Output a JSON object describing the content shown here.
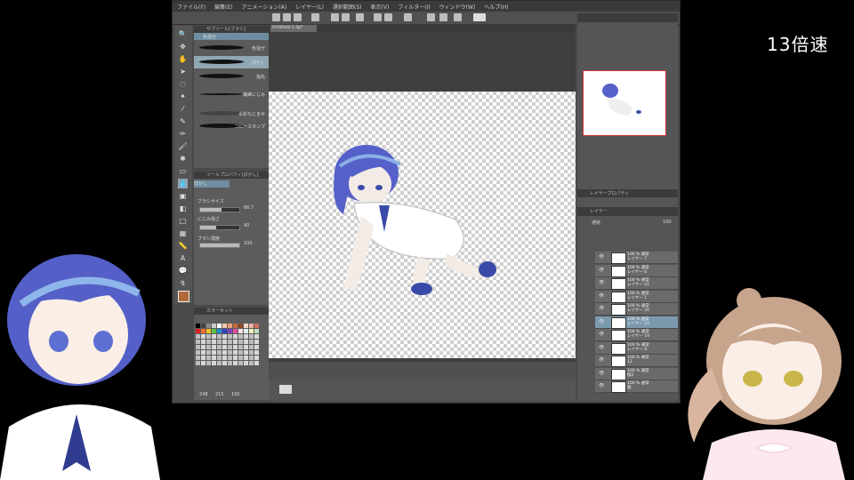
{
  "overlay": {
    "speed_label": "13倍速"
  },
  "menu": [
    "ファイル(F)",
    "編集(E)",
    "アニメーション(A)",
    "レイヤー(L)",
    "選択範囲(S)",
    "表示(V)",
    "フィルター(I)",
    "ウィンドウ(W)",
    "ヘルプ(H)"
  ],
  "subtool": {
    "header": "サブツール[ブラシ]",
    "brushes": [
      {
        "label": "色混ぜ",
        "selected": false
      },
      {
        "label": "ぼかし",
        "selected": true
      },
      {
        "label": "指先",
        "selected": false
      },
      {
        "label": "繊維にじみ",
        "selected": false
      },
      {
        "label": "水彩なじませ",
        "selected": false
      },
      {
        "label": "コピースタンプ",
        "selected": false
      }
    ],
    "top_item": "色混ぜ"
  },
  "toolprop": {
    "header": "ツールプロパティ[ぼかし]",
    "current": "ぼかし",
    "brush_size_label": "ブラシサイズ",
    "brush_size_value": "66.7",
    "brush_size_level": 0.55,
    "blur_strength_label": "にじみ強さ",
    "blur_strength_value": "40",
    "blur_strength_level": 0.4,
    "brush_density_label": "ブラシ濃度",
    "brush_density_value": "100",
    "brush_density_level": 1.0
  },
  "colorset": {
    "header": "カラーセット",
    "footer": [
      "248",
      "215",
      "195"
    ]
  },
  "canvas": {
    "tab_label": "Untitled-1.lip*"
  },
  "layer_panel": {
    "header": "レイヤー",
    "prop_header": "レイヤープロパティ",
    "blend_mode": "通常",
    "opacity": "100",
    "layers": [
      {
        "name": "100 % 通常\nレイヤー 7",
        "selected": false
      },
      {
        "name": "100 % 通常\nレイヤー 6",
        "selected": false
      },
      {
        "name": "100 % 通常\nレイヤー 21",
        "selected": false
      },
      {
        "name": "100 % 通常\nレイヤー 1",
        "selected": false
      },
      {
        "name": "100 % 通常\nレイヤー 20",
        "selected": false
      },
      {
        "name": "100 % 通常\nレイヤー 22",
        "selected": true
      },
      {
        "name": "100 % 通常\nレイヤー 19",
        "selected": false
      },
      {
        "name": "100 % 通常\nレイヤー 8",
        "selected": false
      },
      {
        "name": "100 % 通常\n12",
        "selected": false
      },
      {
        "name": "100 % 通常\n服2",
        "selected": false
      },
      {
        "name": "100 % 通常\n服",
        "selected": false
      }
    ]
  }
}
